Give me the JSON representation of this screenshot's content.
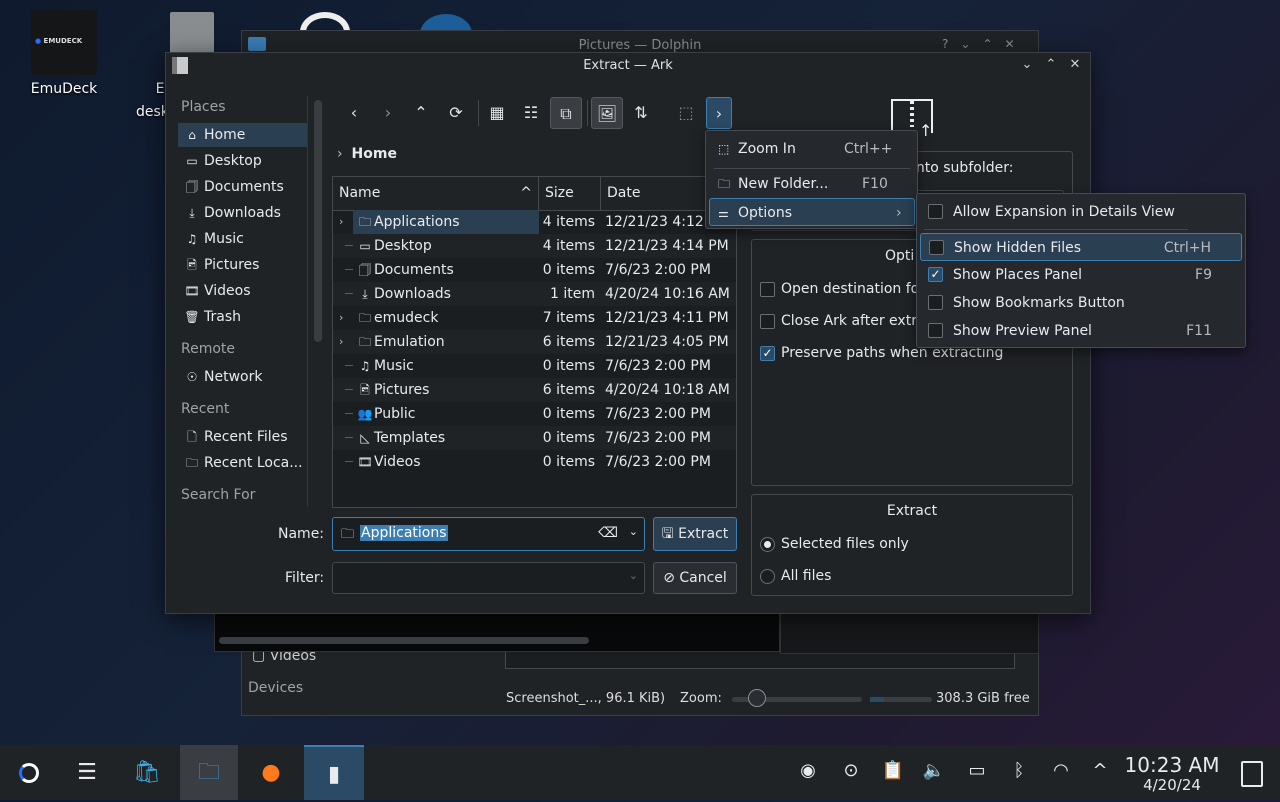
{
  "desktop": {
    "icons": [
      {
        "label": "EmuDeck",
        "logo_text": "EMUDECK"
      },
      {
        "label": "E",
        "label2": "desk"
      }
    ]
  },
  "dolphin": {
    "title": "Pictures — Dolphin",
    "sidebar_videos": "Videos",
    "devices": "Devices",
    "status": "Screenshot_..., 96.1 KiB)",
    "zoom_label": "Zoom:",
    "zoom_level": 0.2,
    "free": "308.3 GiB free",
    "title_buttons": [
      "?",
      "⌄",
      "⌃",
      "✕"
    ]
  },
  "ark": {
    "title": "Extract — Ark",
    "places": {
      "header": "Places",
      "items": [
        {
          "label": "Home",
          "icon": "home-icon"
        },
        {
          "label": "Desktop",
          "icon": "desktop-icon"
        },
        {
          "label": "Documents",
          "icon": "documents-icon"
        },
        {
          "label": "Downloads",
          "icon": "downloads-icon"
        },
        {
          "label": "Music",
          "icon": "music-icon"
        },
        {
          "label": "Pictures",
          "icon": "pictures-icon"
        },
        {
          "label": "Videos",
          "icon": "videos-icon"
        },
        {
          "label": "Trash",
          "icon": "trash-icon"
        }
      ],
      "remote_header": "Remote",
      "remote": [
        {
          "label": "Network"
        }
      ],
      "recent_header": "Recent",
      "recent": [
        {
          "label": "Recent Files"
        },
        {
          "label": "Recent Loca..."
        }
      ],
      "search_header": "Search For"
    },
    "breadcrumb": "Home",
    "columns": [
      "Name",
      "Size",
      "Date"
    ],
    "rows": [
      {
        "name": "Applications",
        "size": "4 items",
        "date": "12/21/23 4:12",
        "expand": true,
        "icon": "folder-icon"
      },
      {
        "name": "Desktop",
        "size": "4 items",
        "date": "12/21/23 4:14 PM",
        "expand": false,
        "icon": "desktop-icon"
      },
      {
        "name": "Documents",
        "size": "0 items",
        "date": "7/6/23 2:00 PM",
        "expand": false,
        "icon": "documents-icon"
      },
      {
        "name": "Downloads",
        "size": "1 item",
        "date": "4/20/24 10:16 AM",
        "expand": false,
        "icon": "downloads-icon"
      },
      {
        "name": "emudeck",
        "size": "7 items",
        "date": "12/21/23 4:11 PM",
        "expand": true,
        "icon": "folder-icon"
      },
      {
        "name": "Emulation",
        "size": "6 items",
        "date": "12/21/23 4:05 PM",
        "expand": true,
        "icon": "folder-icon"
      },
      {
        "name": "Music",
        "size": "0 items",
        "date": "7/6/23 2:00 PM",
        "expand": false,
        "icon": "music-icon"
      },
      {
        "name": "Pictures",
        "size": "6 items",
        "date": "4/20/24 10:18 AM",
        "expand": false,
        "icon": "pictures-icon"
      },
      {
        "name": "Public",
        "size": "0 items",
        "date": "7/6/23 2:00 PM",
        "expand": false,
        "icon": "public-icon"
      },
      {
        "name": "Templates",
        "size": "0 items",
        "date": "7/6/23 2:00 PM",
        "expand": false,
        "icon": "templates-icon"
      },
      {
        "name": "Videos",
        "size": "0 items",
        "date": "7/6/23 2:00 PM",
        "expand": false,
        "icon": "videos-icon"
      }
    ],
    "name_label": "Name:",
    "name_value": "Applications",
    "filter_label": "Filter:",
    "filter_value": "",
    "extract_button": "Extract",
    "cancel_button": "Cancel",
    "subfolder_label": "into subfolder:",
    "options_title": "Opti",
    "options": [
      {
        "label": "Open destination fo",
        "checked": false
      },
      {
        "label": "Close Ark after extr",
        "checked": false
      },
      {
        "label": "Preserve paths when extracting",
        "checked": true
      }
    ],
    "extract_group": {
      "title": "Extract",
      "choices": [
        {
          "label": "Selected files only",
          "selected": true
        },
        {
          "label": "All files",
          "selected": false
        }
      ]
    }
  },
  "menu": {
    "items": [
      {
        "label": "Zoom In",
        "shortcut": "Ctrl++"
      },
      {
        "label": "New Folder...",
        "shortcut": "F10"
      },
      {
        "label": "Options"
      }
    ]
  },
  "submenu": {
    "items": [
      {
        "label": "Allow Expansion in Details View",
        "checked": false,
        "shortcut": ""
      },
      {
        "label": "Show Hidden Files",
        "checked": false,
        "shortcut": "Ctrl+H"
      },
      {
        "label": "Show Places Panel",
        "checked": true,
        "shortcut": "F9"
      },
      {
        "label": "Show Bookmarks Button",
        "checked": false,
        "shortcut": ""
      },
      {
        "label": "Show Preview Panel",
        "checked": false,
        "shortcut": "F11"
      }
    ]
  },
  "taskbar": {
    "time": "10:23 AM",
    "date": "4/20/24"
  },
  "colors": {
    "accent": "#3d7fb3",
    "selection": "#2b3f52",
    "window": "#202326"
  }
}
